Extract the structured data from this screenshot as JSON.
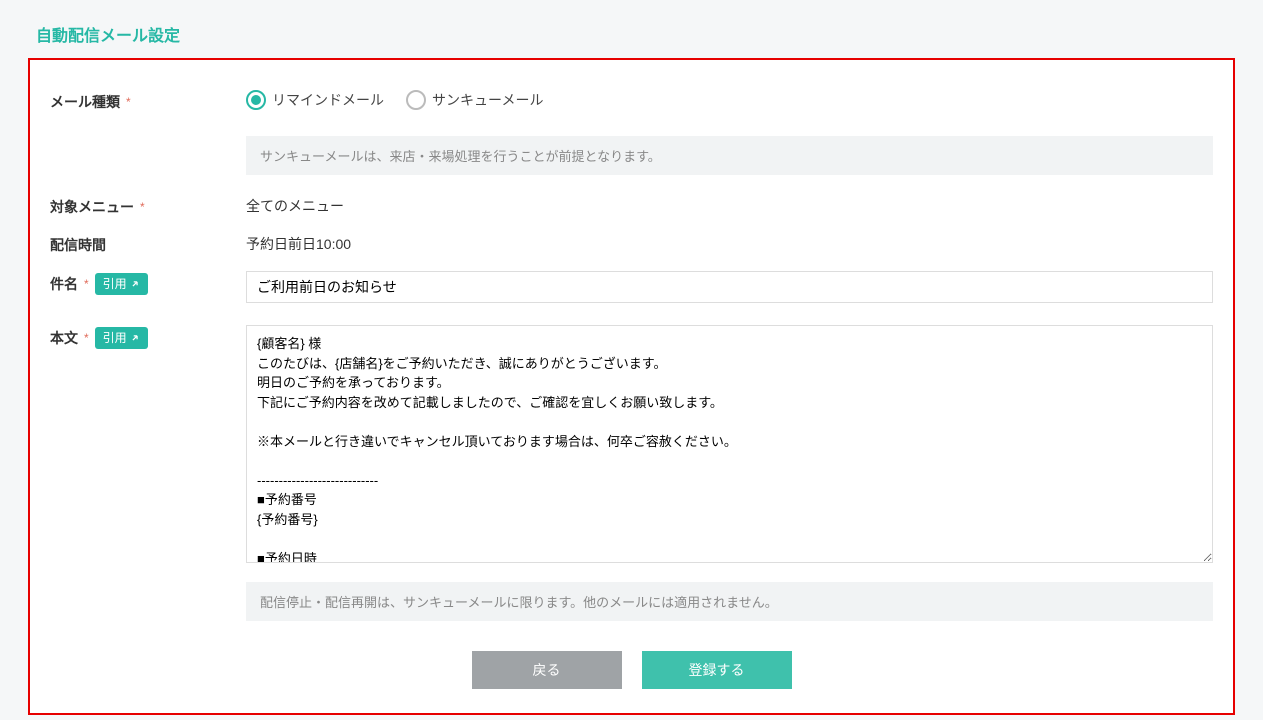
{
  "page_title": "自動配信メール設定",
  "labels": {
    "mail_type": "メール種類",
    "target_menu": "対象メニュー",
    "delivery_time": "配信時間",
    "subject": "件名",
    "body": "本文",
    "quote": "引用"
  },
  "mail_type": {
    "options": [
      {
        "label": "リマインドメール",
        "selected": true
      },
      {
        "label": "サンキューメール",
        "selected": false
      }
    ],
    "note": "サンキューメールは、来店・来場処理を行うことが前提となります。"
  },
  "target_menu_value": "全てのメニュー",
  "delivery_time_value": "予約日前日10:00",
  "subject_value": "ご利用前日のお知らせ",
  "body_value": "{顧客名} 様\nこのたびは、{店舗名}をご予約いただき、誠にありがとうございます。\n明日のご予約を承っております。\n下記にご予約内容を改めて記載しましたので、ご確認を宜しくお願い致します。\n\n※本メールと行き違いでキャンセル頂いております場合は、何卒ご容赦ください。\n\n----------------------------\n■予約番号\n{予約番号}\n\n■予約日時\n{予約日時}\n\n■予約メニュー\n{カテゴリ} {予約内容}",
  "bottom_note": "配信停止・配信再開は、サンキューメールに限ります。他のメールには適用されません。",
  "buttons": {
    "back": "戻る",
    "submit": "登録する"
  }
}
